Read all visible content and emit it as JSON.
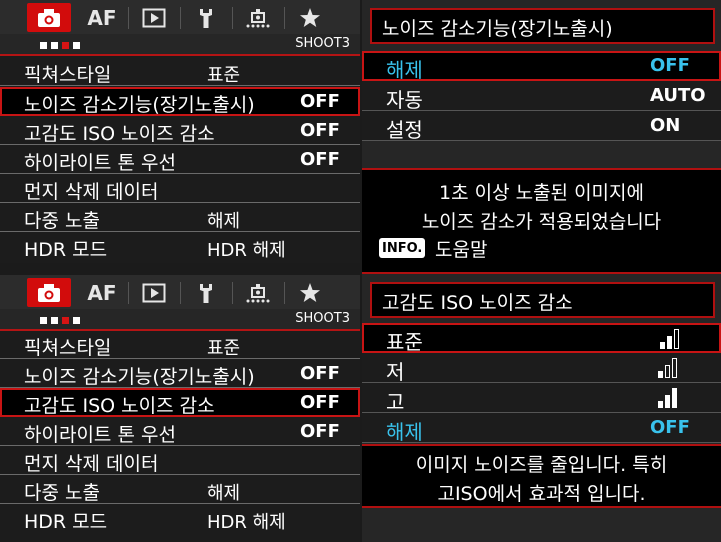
{
  "shooting_menu": {
    "tabs": [
      {
        "label": "",
        "icon": "camera-icon"
      },
      {
        "label": "AF",
        "icon": ""
      },
      {
        "label": "",
        "icon": "play-icon"
      },
      {
        "label": "",
        "icon": "wrench-icon"
      },
      {
        "label": "",
        "icon": "custom-function-icon"
      },
      {
        "label": "",
        "icon": "star-icon"
      }
    ],
    "page_label": "SHOOT3",
    "items": [
      {
        "label": "픽쳐스타일",
        "value": "표준"
      },
      {
        "label": "노이즈 감소기능(장기노출시)",
        "value": "OFF"
      },
      {
        "label": "고감도 ISO 노이즈 감소",
        "value": "OFF"
      },
      {
        "label": "하이라이트 톤 우선",
        "value": "OFF"
      },
      {
        "label": "먼지 삭제 데이터",
        "value": ""
      },
      {
        "label": "다중 노출",
        "value": "해제"
      },
      {
        "label": "HDR 모드",
        "value": "HDR 해제"
      }
    ]
  },
  "long_exposure_nr": {
    "title": "노이즈 감소기능(장기노출시)",
    "options": [
      {
        "label": "해제",
        "value": "OFF"
      },
      {
        "label": "자동",
        "value": "AUTO"
      },
      {
        "label": "설정",
        "value": "ON"
      }
    ],
    "help_line1": "1초 이상 노출된 이미지에",
    "help_line2": "노이즈 감소가 적용되었습니다",
    "info_badge": "INFO.",
    "help_label": "도움말"
  },
  "high_iso_nr": {
    "title": "고감도 ISO 노이즈 감소",
    "options": [
      {
        "label": "표준",
        "value": "",
        "level": 2
      },
      {
        "label": "저",
        "value": "",
        "level": 1
      },
      {
        "label": "고",
        "value": "",
        "level": 3
      },
      {
        "label": "해제",
        "value": "OFF",
        "level": 0
      }
    ],
    "help_line1": "이미지 노이즈를 줄입니다. 특히",
    "help_line2": "고ISO에서 효과적 입니다."
  },
  "colors": {
    "accent_red": "#d20c0c",
    "selection_cyan": "#39c2ec",
    "background": "#1c1c1c"
  }
}
